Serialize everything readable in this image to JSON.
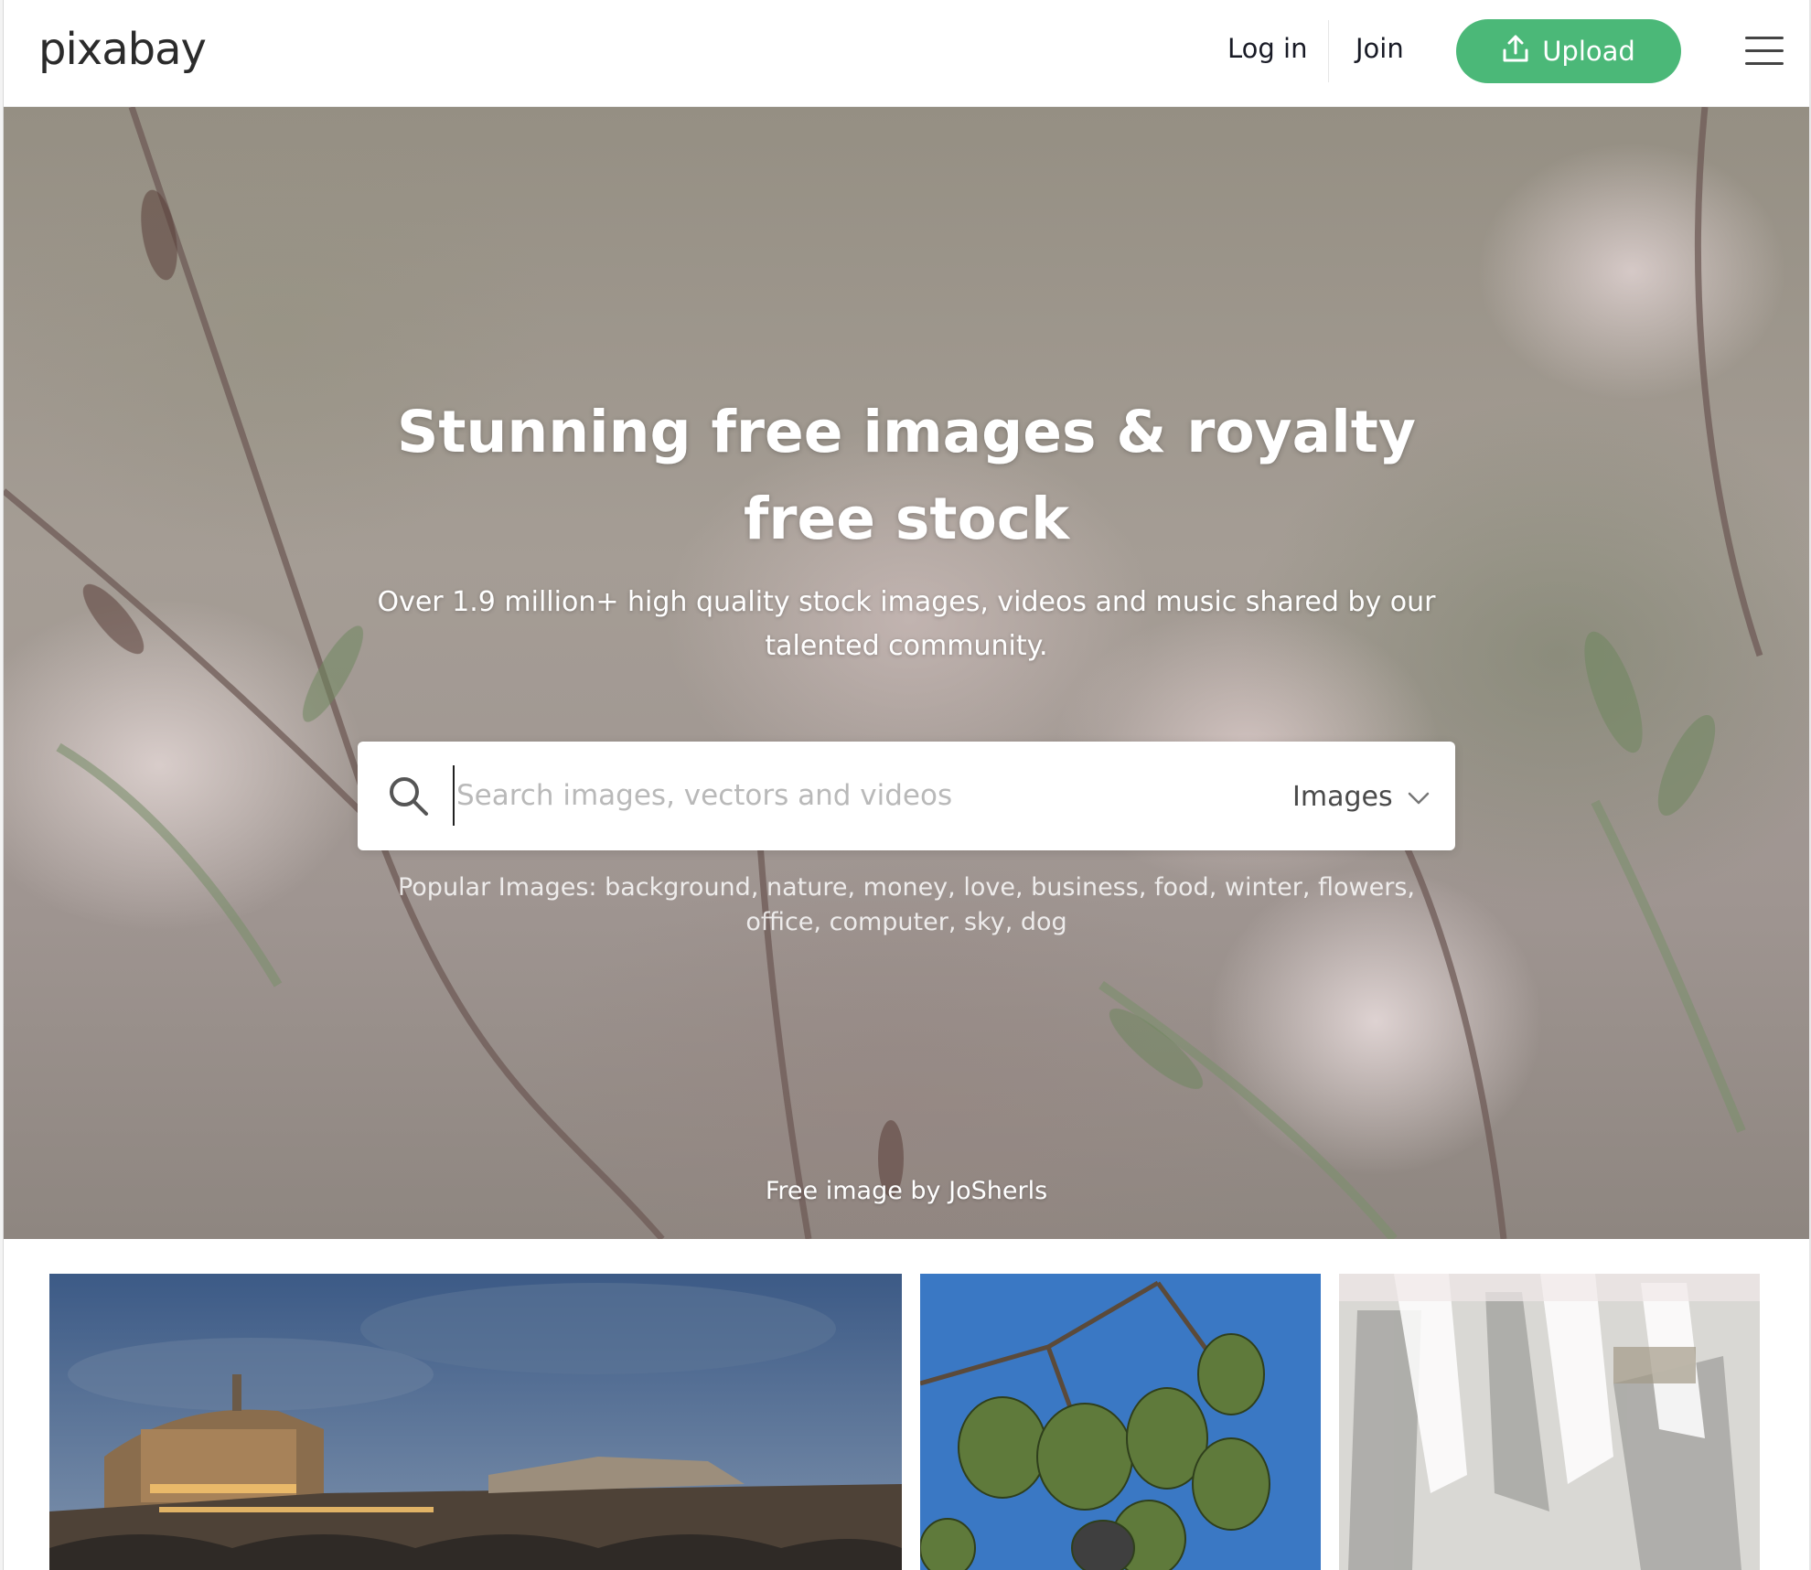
{
  "header": {
    "logo_text": "pixabay",
    "login_label": "Log in",
    "join_label": "Join",
    "upload_label": "Upload",
    "upload_icon": "upload-icon",
    "menu_icon": "hamburger-menu-icon",
    "accent_color": "#4bb878"
  },
  "hero": {
    "title": "Stunning free images & royalty free stock",
    "subtitle": "Over 1.9 million+ high quality stock images, videos and music shared by our talented community.",
    "search": {
      "placeholder": "Search images, vectors and videos",
      "value": "",
      "type_selected": "Images",
      "search_icon": "search-icon"
    },
    "popular": {
      "prefix": "Popular Images:",
      "tags": [
        "background",
        "nature",
        "money",
        "love",
        "business",
        "food",
        "winter",
        "flowers",
        "office",
        "computer",
        "sky",
        "dog"
      ]
    },
    "credit": "Free image by JoSherls"
  },
  "gallery": {
    "items": [
      {
        "subject": "castle-by-river-at-dusk"
      },
      {
        "subject": "green-fruits-on-branch-blue-sky"
      },
      {
        "subject": "abstract-white-gray-paint-strokes"
      }
    ]
  }
}
